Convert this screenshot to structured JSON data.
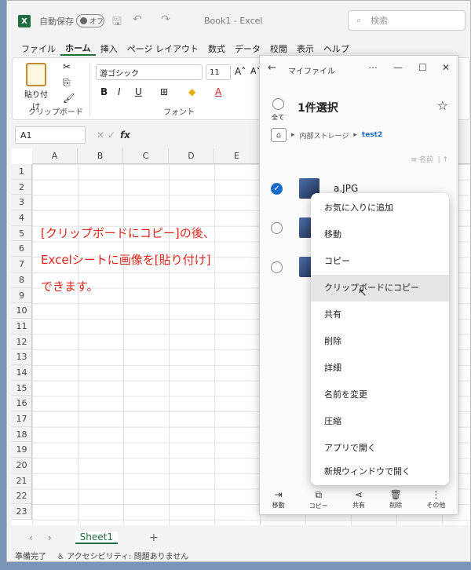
{
  "titlebar": {
    "app_icon": "X",
    "autosave_label": "自動保存",
    "toggle_label": "オフ",
    "doc_title": "Book1 - Excel",
    "search_placeholder": "検索"
  },
  "menu": [
    "ファイル",
    "ホーム",
    "挿入",
    "ページ レイアウト",
    "数式",
    "データ",
    "校閲",
    "表示",
    "ヘルプ"
  ],
  "ribbon": {
    "paste_label": "貼り付け",
    "clipboard_group": "クリップボード",
    "font_name": "游ゴシック",
    "font_size": "11",
    "font_group": "フォント",
    "bold": "B",
    "italic": "I",
    "underline": "U"
  },
  "formula_bar": {
    "name_box": "A1",
    "fx": "fx"
  },
  "grid": {
    "columns": [
      "A",
      "B",
      "C",
      "D",
      "E"
    ],
    "rows": [
      "1",
      "2",
      "3",
      "4",
      "5",
      "6",
      "7",
      "8",
      "9",
      "10",
      "11",
      "12",
      "13",
      "14",
      "15",
      "16",
      "17",
      "18",
      "19",
      "20",
      "21",
      "22",
      "23"
    ]
  },
  "note": {
    "line1": "[クリップボードにコピー]の後、",
    "line2": "Excelシートに画像を[貼り付け]",
    "line3": "できます。"
  },
  "sheet": {
    "tab": "Sheet1",
    "add": "+"
  },
  "status": {
    "ready": "準備完了",
    "accessibility": "アクセシビリティ: 問題ありません"
  },
  "app": {
    "title": "マイファイル",
    "select_all": "全て",
    "selected": "1件選択",
    "crumb_storage": "内部ストレージ",
    "crumb_folder": "test2",
    "sort_label": "名前",
    "file_name": "a.JPG",
    "context_menu": [
      "お気に入りに追加",
      "移動",
      "コピー",
      "クリップボードにコピー",
      "共有",
      "削除",
      "詳細",
      "名前を変更",
      "圧縮",
      "アプリで開く",
      "新規ウィンドウで開く"
    ],
    "bottom": [
      "移動",
      "コピー",
      "共有",
      "削除",
      "その他"
    ]
  }
}
